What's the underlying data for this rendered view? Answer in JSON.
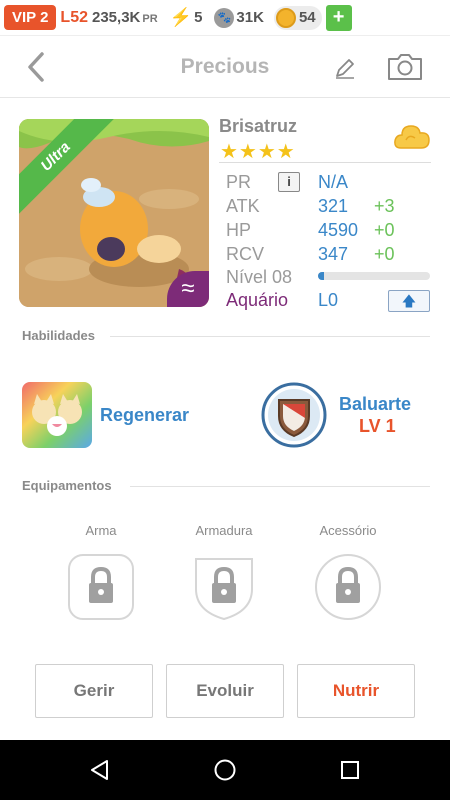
{
  "status": {
    "vip": "VIP 2",
    "level": "L52",
    "pr_value": "235,3K",
    "pr_unit": "PR",
    "energy": "5",
    "paws": "31K",
    "coins": "54",
    "plus": "+"
  },
  "header": {
    "title": "Precious",
    "back_icon": "chevron-left-icon",
    "edit_icon": "pencil-icon",
    "camera_icon": "camera-icon"
  },
  "pet": {
    "rarity": "Ultra",
    "element_symbol": "≈",
    "name": "Brisatruz",
    "stars": "★★★★",
    "star_count": 4,
    "stats": {
      "pr_label": "PR",
      "pr_info": "i",
      "pr_value": "N/A",
      "atk_label": "ATK",
      "atk_value": "321",
      "atk_bonus": "+3",
      "hp_label": "HP",
      "hp_value": "4590",
      "hp_bonus": "+0",
      "rcv_label": "RCV",
      "rcv_value": "347",
      "rcv_bonus": "+0",
      "level_label": "Nível 08",
      "level_progress": 0.05,
      "habitat_label": "Aquário",
      "habitat_value": "L0",
      "upgrade_icon": "arrow-up-icon"
    }
  },
  "skills": {
    "section": "Habilidades",
    "items": [
      {
        "name": "Regenerar",
        "icon": "cats-icon"
      },
      {
        "name": "Baluarte",
        "level": "LV 1",
        "icon": "shield-icon"
      }
    ]
  },
  "equipment": {
    "section": "Equipamentos",
    "slots": [
      {
        "label": "Arma",
        "icon": "lock-icon"
      },
      {
        "label": "Armadura",
        "icon": "lock-icon"
      },
      {
        "label": "Acessório",
        "icon": "lock-icon"
      }
    ]
  },
  "actions": {
    "manage": "Gerir",
    "evolve": "Evoluir",
    "feed": "Nutrir"
  },
  "colors": {
    "accent_orange": "#e8542b",
    "link_blue": "#3a87c8",
    "bonus_green": "#6bc25a",
    "aqua_purple": "#7d2b78",
    "star_yellow": "#f4c21a"
  }
}
